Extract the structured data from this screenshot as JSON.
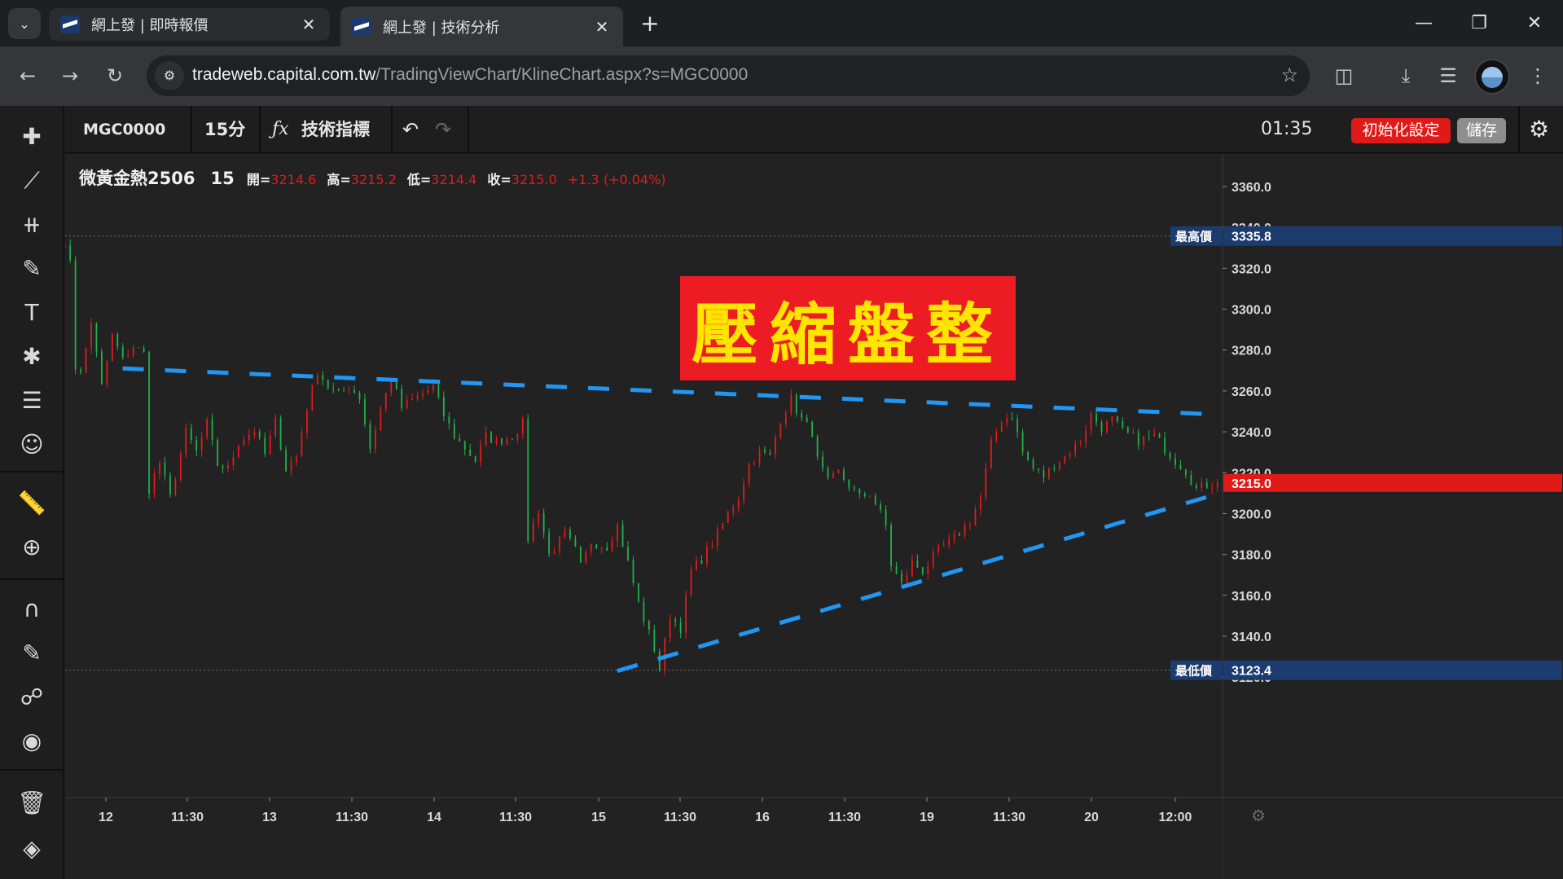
{
  "browser": {
    "tabs": [
      {
        "title": "網上發 | 即時報價",
        "active": false
      },
      {
        "title": "網上發 | 技術分析",
        "active": true
      }
    ],
    "url_host": "tradeweb.capital.com.tw",
    "url_path": "/TradingViewChart/KlineChart.aspx?s=MGC0000"
  },
  "toolbar": {
    "symbol": "MGC0000",
    "interval": "15分",
    "indicators_label": "技術指標",
    "clock": "01:35",
    "reset_label": "初始化設定",
    "save_label": "儲存"
  },
  "legend": {
    "name": "微黃金熱2506",
    "resolution": "15",
    "open_label": "開=",
    "open": "3214.6",
    "high_label": "高=",
    "high": "3215.2",
    "low_label": "低=",
    "low": "3214.4",
    "close_label": "收=",
    "close": "3215.0",
    "change": "+1.3 (+0.04%)"
  },
  "banner": {
    "text": "壓縮盤整"
  },
  "colors": {
    "up": "#e21b1b",
    "down": "#22b14c",
    "trend": "#2196f3",
    "banner_bg": "#ed1c24",
    "banner_text": "#ffe500"
  },
  "chart_data": {
    "type": "candlestick",
    "title": "",
    "ylim": [
      3110,
      3370
    ],
    "y_ticks": [
      "3360.0",
      "3340.0",
      "3320.0",
      "3300.0",
      "3280.0",
      "3260.0",
      "3240.0",
      "3220.0",
      "3200.0",
      "3180.0",
      "3160.0",
      "3140.0",
      "3120.0"
    ],
    "x_ticks": [
      "12",
      "11:30",
      "13",
      "11:30",
      "14",
      "11:30",
      "15",
      "11:30",
      "16",
      "11:30",
      "19",
      "11:30",
      "20",
      "12:00"
    ],
    "highest": {
      "label": "最高價",
      "value": "3335.8"
    },
    "lowest": {
      "label": "最低價",
      "value": "3123.4"
    },
    "last_price": "3215.0",
    "price_path": [
      [
        0,
        3333
      ],
      [
        1.5,
        3325
      ],
      [
        2,
        3272
      ],
      [
        3,
        3268
      ],
      [
        5,
        3294
      ],
      [
        7,
        3262
      ],
      [
        9,
        3287
      ],
      [
        11,
        3275
      ],
      [
        12.5,
        3282
      ],
      [
        14,
        3278
      ],
      [
        15,
        3212
      ],
      [
        17,
        3225
      ],
      [
        19,
        3208
      ],
      [
        22,
        3240
      ],
      [
        24,
        3230
      ],
      [
        26,
        3244
      ],
      [
        28,
        3224
      ],
      [
        30,
        3222
      ],
      [
        32,
        3235
      ],
      [
        35,
        3241
      ],
      [
        37,
        3229
      ],
      [
        39,
        3245
      ],
      [
        41,
        3222
      ],
      [
        43,
        3228
      ],
      [
        45,
        3252
      ],
      [
        47,
        3270
      ],
      [
        49,
        3262
      ],
      [
        51,
        3258
      ],
      [
        53,
        3262
      ],
      [
        55,
        3257
      ],
      [
        57,
        3232
      ],
      [
        59,
        3251
      ],
      [
        61,
        3266
      ],
      [
        63,
        3252
      ],
      [
        66,
        3257
      ],
      [
        69,
        3262
      ],
      [
        71,
        3248
      ],
      [
        73,
        3238
      ],
      [
        75,
        3232
      ],
      [
        77,
        3226
      ],
      [
        79,
        3238
      ],
      [
        81,
        3235
      ],
      [
        84,
        3238
      ],
      [
        86,
        3244
      ],
      [
        87,
        3188
      ],
      [
        89,
        3202
      ],
      [
        91,
        3180
      ],
      [
        94,
        3190
      ],
      [
        96,
        3182
      ],
      [
        97,
        3174
      ],
      [
        99,
        3186
      ],
      [
        102,
        3184
      ],
      [
        104,
        3194
      ],
      [
        106,
        3176
      ],
      [
        108,
        3156
      ],
      [
        111,
        3134
      ],
      [
        112,
        3124
      ],
      [
        114,
        3150
      ],
      [
        116,
        3144
      ],
      [
        118,
        3172
      ],
      [
        120,
        3178
      ],
      [
        123,
        3190
      ],
      [
        125,
        3200
      ],
      [
        127,
        3208
      ],
      [
        129,
        3224
      ],
      [
        131,
        3230
      ],
      [
        133,
        3228
      ],
      [
        135,
        3246
      ],
      [
        137,
        3256
      ],
      [
        139,
        3246
      ],
      [
        141,
        3240
      ],
      [
        142,
        3226
      ],
      [
        144,
        3215
      ],
      [
        146,
        3220
      ],
      [
        148,
        3214
      ],
      [
        150,
        3208
      ],
      [
        152,
        3210
      ],
      [
        154,
        3200
      ],
      [
        155,
        3194
      ],
      [
        156,
        3175
      ],
      [
        158,
        3165
      ],
      [
        160,
        3176
      ],
      [
        162,
        3172
      ],
      [
        165,
        3182
      ],
      [
        168,
        3188
      ],
      [
        171,
        3196
      ],
      [
        173,
        3208
      ],
      [
        175,
        3234
      ],
      [
        177,
        3246
      ],
      [
        179,
        3248
      ],
      [
        181,
        3230
      ],
      [
        183,
        3222
      ],
      [
        185,
        3218
      ],
      [
        187,
        3224
      ],
      [
        189,
        3228
      ],
      [
        192,
        3236
      ],
      [
        194,
        3248
      ],
      [
        196,
        3242
      ],
      [
        198,
        3246
      ],
      [
        200,
        3240
      ],
      [
        203,
        3236
      ],
      [
        206,
        3238
      ],
      [
        208,
        3232
      ],
      [
        210,
        3226
      ],
      [
        212,
        3221
      ],
      [
        214,
        3212
      ],
      [
        216,
        3214
      ],
      [
        218,
        3215
      ]
    ],
    "trendlines": [
      {
        "name": "",
        "from": [
          12.3,
          3271
        ],
        "to": [
          222,
          3248
        ]
      },
      {
        "name": "",
        "from": [
          105,
          3123
        ],
        "to": [
          218,
          3210
        ]
      }
    ]
  }
}
